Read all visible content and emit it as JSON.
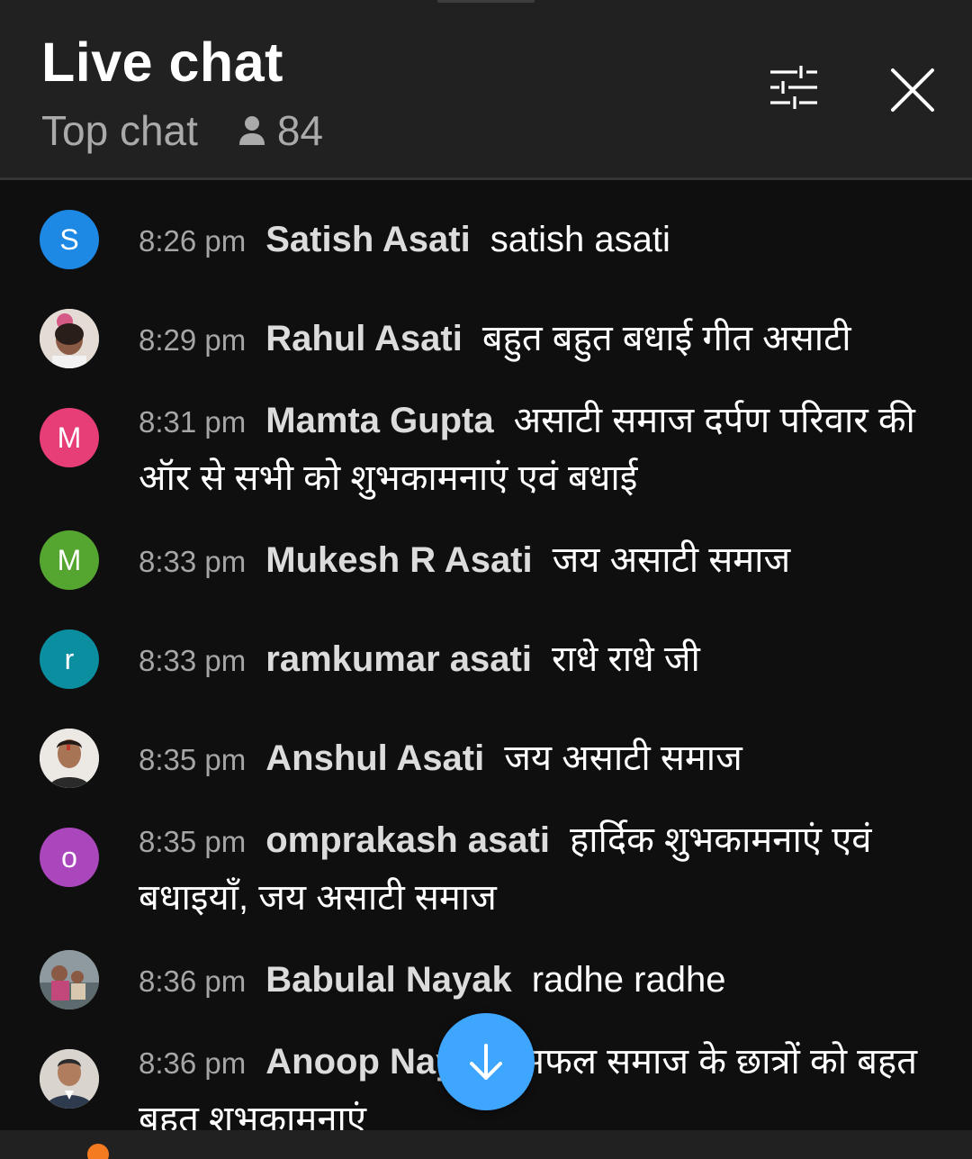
{
  "header": {
    "title": "Live chat",
    "mode": "Top chat",
    "viewer_count": "84"
  },
  "messages": [
    {
      "time": "8:26 pm",
      "author": "Satish Asati",
      "text": "satish asati",
      "avatar": {
        "type": "letter",
        "letter": "S",
        "color": "#1e88e5"
      }
    },
    {
      "time": "8:29 pm",
      "author": "Rahul Asati",
      "text": "बहुत बहुत बधाई गीत असाटी",
      "avatar": {
        "type": "photo",
        "icon": "child-photo-avatar"
      }
    },
    {
      "time": "8:31 pm",
      "author": "Mamta Gupta",
      "text": "असाटी समाज दर्पण परिवार की ऑर से सभी को शुभकामनाएं एवं बधाई",
      "avatar": {
        "type": "letter",
        "letter": "M",
        "color": "#e83e78"
      }
    },
    {
      "time": "8:33 pm",
      "author": "Mukesh R Asati",
      "text": "जय असाटी समाज",
      "avatar": {
        "type": "letter",
        "letter": "M",
        "color": "#55a630"
      }
    },
    {
      "time": "8:33 pm",
      "author": "ramkumar asati",
      "text": "राधे राधे जी",
      "avatar": {
        "type": "letter",
        "letter": "r",
        "color": "#0a8ea0"
      }
    },
    {
      "time": "8:35 pm",
      "author": "Anshul Asati",
      "text": "जय असाटी समाज",
      "avatar": {
        "type": "photo",
        "icon": "man-photo-avatar"
      }
    },
    {
      "time": "8:35 pm",
      "author": "omprakash asati",
      "text": "हार्दिक शुभकामनाएं एवं बधाइयाँ, जय असाटी समाज",
      "avatar": {
        "type": "letter",
        "letter": "o",
        "color": "#ab47bc"
      }
    },
    {
      "time": "8:36 pm",
      "author": "Babulal Nayak",
      "text": "radhe radhe",
      "avatar": {
        "type": "photo",
        "icon": "family-photo-avatar"
      }
    },
    {
      "time": "8:36 pm",
      "author": "Anoop Nay",
      "text": "भी सफल समाज के छात्रों को बहत बहत शभकामनाएं",
      "avatar": {
        "type": "photo",
        "icon": "man-suit-photo-avatar"
      }
    }
  ],
  "icons": {
    "filter": "tune-sliders-icon",
    "close": "close-icon",
    "viewers": "person-icon",
    "scroll_down": "arrow-down-icon"
  },
  "colors": {
    "background": "#0f0f0f",
    "header": "#212121",
    "accent": "#3ea6ff",
    "timestamp": "#a6a6a6",
    "author": "#dcdcdc"
  }
}
